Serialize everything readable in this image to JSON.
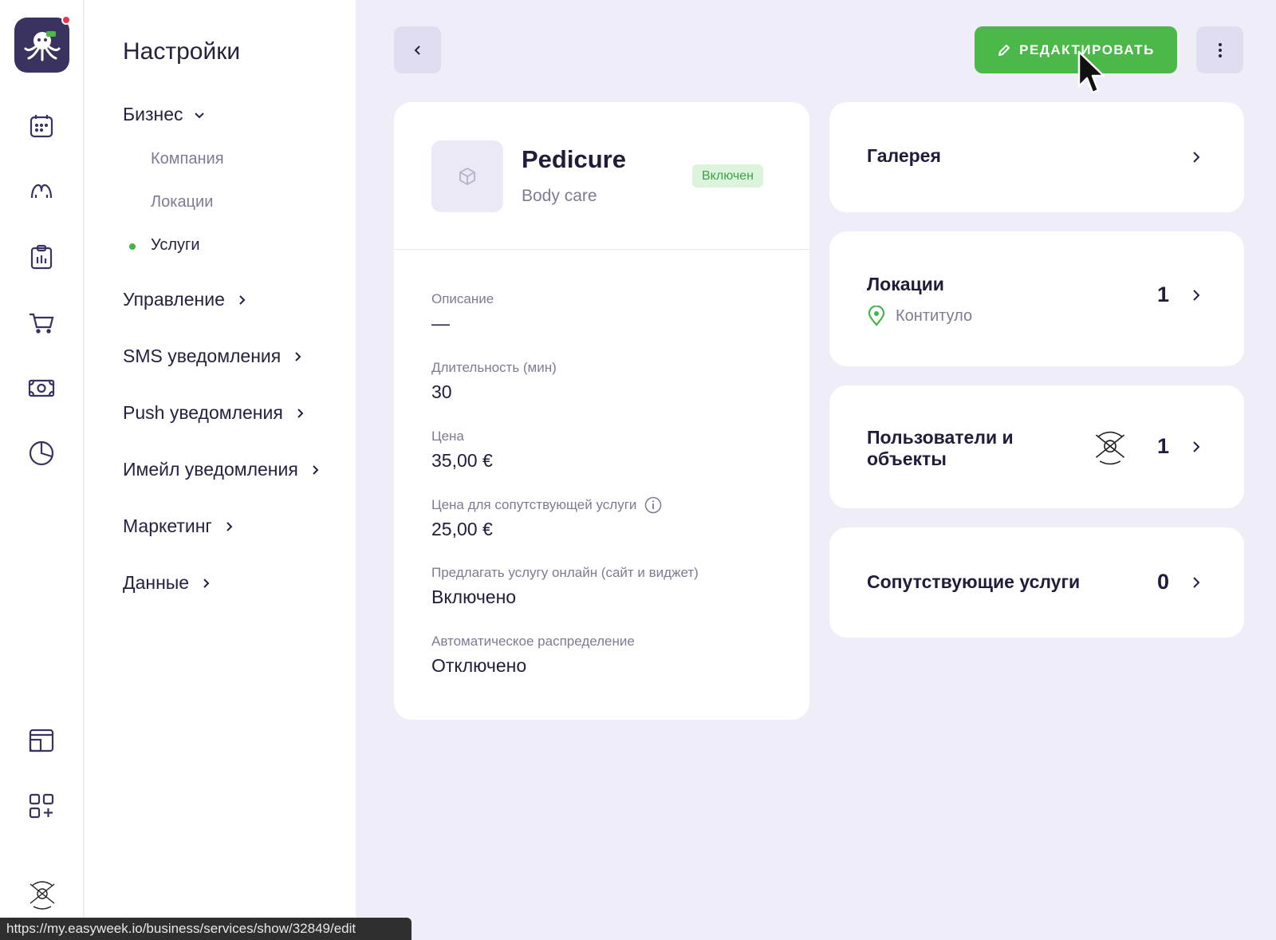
{
  "nav": {
    "title": "Настройки",
    "business": "Бизнес",
    "company": "Компания",
    "locations": "Локации",
    "services": "Услуги",
    "management": "Управление",
    "sms": "SMS уведомления",
    "push": "Push уведомления",
    "email": "Имейл уведомления",
    "marketing": "Маркетинг",
    "data": "Данные"
  },
  "toolbar": {
    "edit_label": "РЕДАКТИРОВАТЬ"
  },
  "service": {
    "name": "Pedicure",
    "category": "Body care",
    "status": "Включен",
    "fields": [
      {
        "label": "Описание",
        "value": "—"
      },
      {
        "label": "Длительность (мин)",
        "value": "30"
      },
      {
        "label": "Цена",
        "value": "35,00 €"
      },
      {
        "label": "Цена для сопутствующей услуги",
        "value": "25,00 €"
      },
      {
        "label": "Предлагать услугу онлайн (сайт и виджет)",
        "value": "Включено"
      },
      {
        "label": "Автоматическое распределение",
        "value": "Отключено"
      }
    ]
  },
  "side": {
    "gallery": {
      "title": "Галерея"
    },
    "locations": {
      "title": "Локации",
      "count": "1",
      "location_name": "Контитуло"
    },
    "users": {
      "title": "Пользователи и объекты",
      "count": "1"
    },
    "related": {
      "title": "Сопутствующие услуги",
      "count": "0"
    }
  },
  "status_bar": {
    "url": "https://my.easyweek.io/business/services/show/32849/edit"
  },
  "colors": {
    "accent_green": "#4cb84a",
    "logo_bg": "#3a335f",
    "page_bg": "#efedf8"
  }
}
